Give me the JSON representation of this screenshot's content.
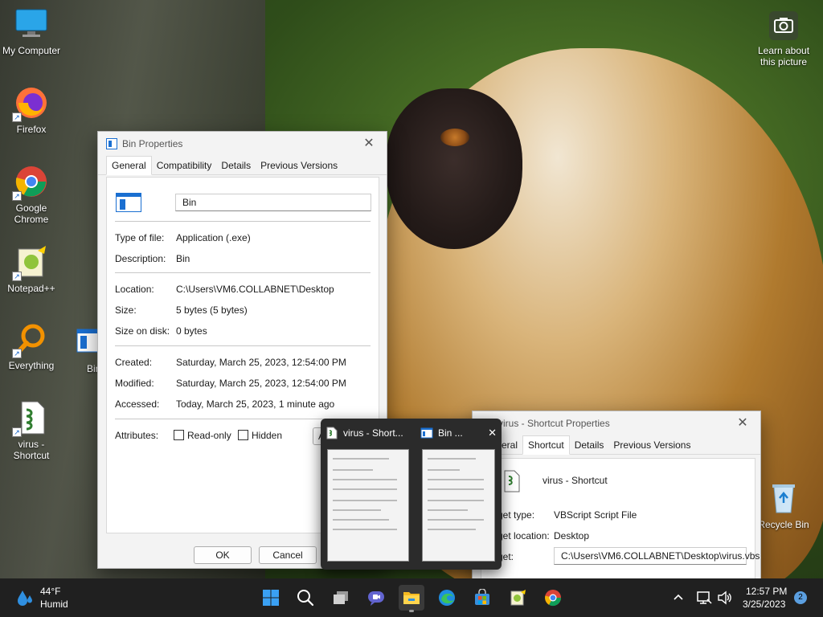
{
  "desktop": {
    "icons": [
      {
        "label": "My Computer"
      },
      {
        "label": "Firefox"
      },
      {
        "label": "Google Chrome"
      },
      {
        "label": "Notepad++"
      },
      {
        "label": "Everything"
      },
      {
        "label": "Bin"
      },
      {
        "label": "virus - Shortcut"
      },
      {
        "label": "Recycle Bin"
      }
    ],
    "learn_about": {
      "label": "Learn about this picture"
    }
  },
  "bin_properties": {
    "title": "Bin Properties",
    "tabs": [
      "General",
      "Compatibility",
      "Details",
      "Previous Versions"
    ],
    "active_tab": "General",
    "file_name": "Bin",
    "rows": {
      "type_label": "Type of file:",
      "type_value": "Application (.exe)",
      "desc_label": "Description:",
      "desc_value": "Bin",
      "location_label": "Location:",
      "location_value": "C:\\Users\\VM6.COLLABNET\\Desktop",
      "size_label": "Size:",
      "size_value": "5 bytes (5 bytes)",
      "sizeondisk_label": "Size on disk:",
      "sizeondisk_value": "0 bytes",
      "created_label": "Created:",
      "created_value": "Saturday, March 25, 2023, 12:54:00 PM",
      "modified_label": "Modified:",
      "modified_value": "Saturday, March 25, 2023, 12:54:00 PM",
      "accessed_label": "Accessed:",
      "accessed_value": "Today, March 25, 2023, 1 minute ago",
      "attributes_label": "Attributes:",
      "readonly_label": "Read-only",
      "hidden_label": "Hidden",
      "advanced_partial": "A"
    },
    "ok_label": "OK",
    "cancel_label": "Cancel"
  },
  "shortcut_properties": {
    "title": "virus - Shortcut Properties",
    "tabs": [
      "eral",
      "Shortcut",
      "Details",
      "Previous Versions"
    ],
    "active_tab": "Shortcut",
    "name": "virus - Shortcut",
    "target_type_label": "get type:",
    "target_type_value": "VBScript Script File",
    "target_location_label": "get location:",
    "target_location_value": "Desktop",
    "target_label": "get:",
    "target_value": "C:\\Users\\VM6.COLLABNET\\Desktop\\virus.vbs"
  },
  "thumbnails": [
    {
      "title": "virus - Short..."
    },
    {
      "title": "Bin ..."
    }
  ],
  "thumbnail_close": "✕",
  "taskbar": {
    "weather_temp": "44°F",
    "weather_desc": "Humid",
    "time": "12:57 PM",
    "date": "3/25/2023",
    "notification_count": "2"
  }
}
